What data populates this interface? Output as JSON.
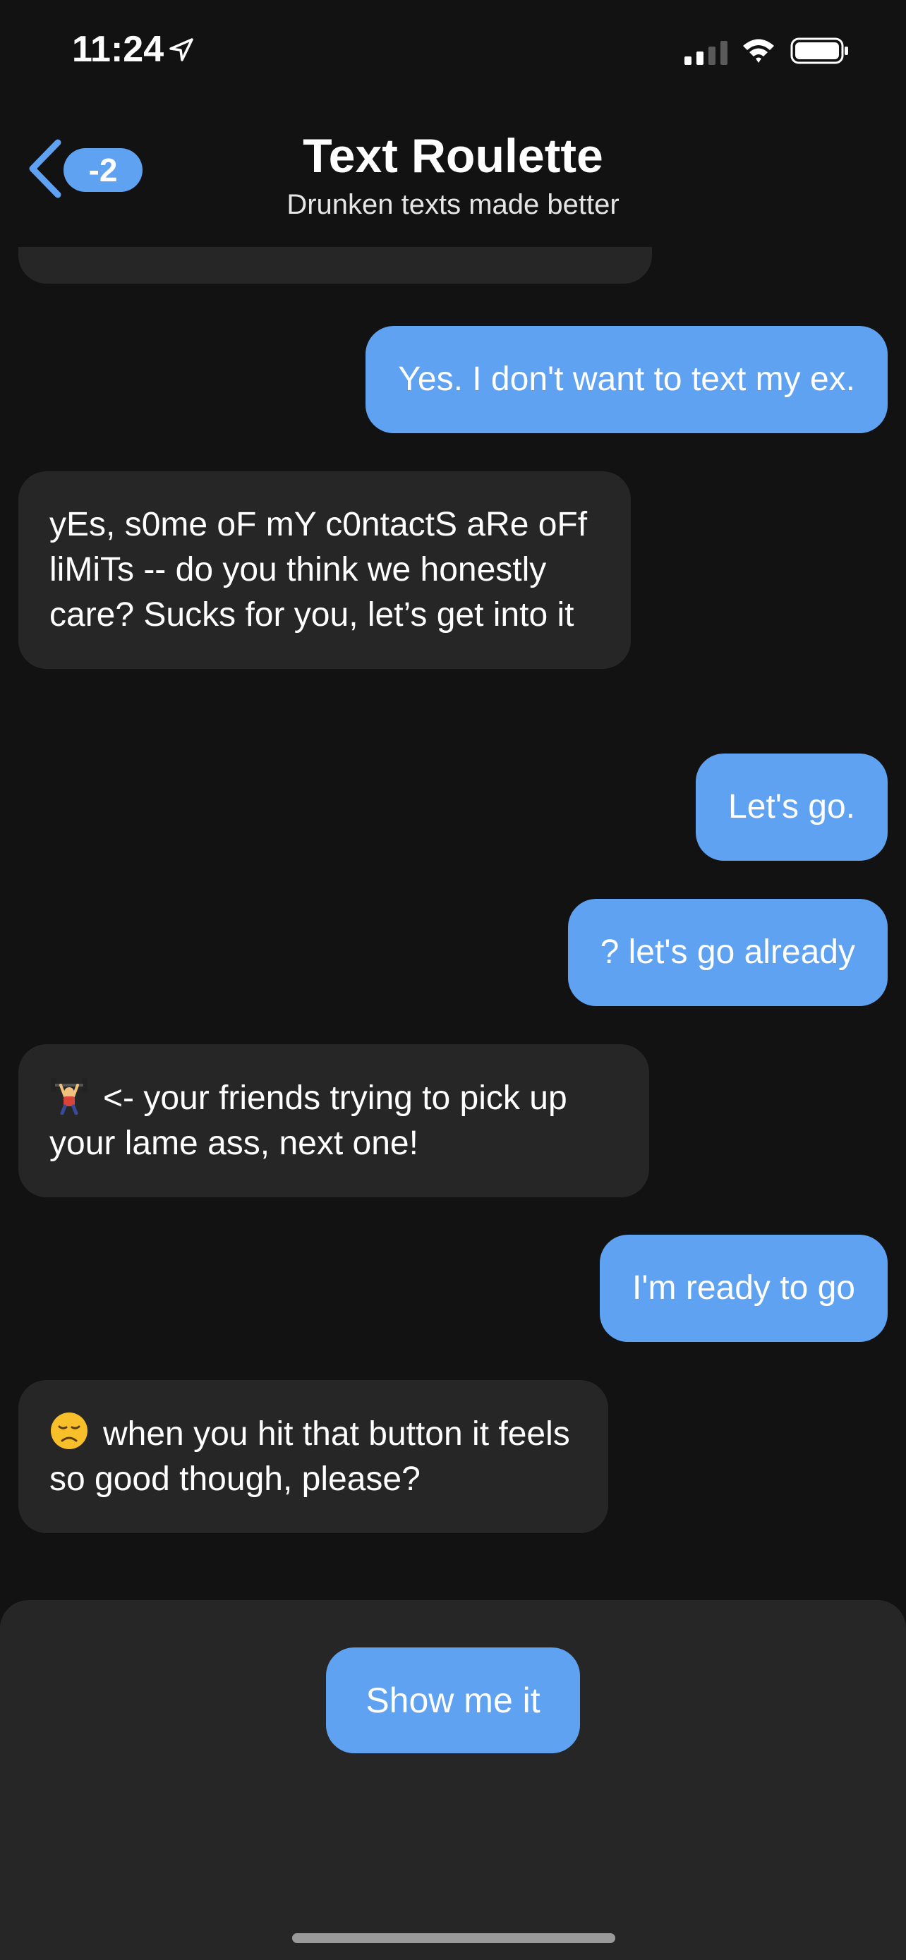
{
  "status_bar": {
    "time": "11:24",
    "location_icon": "location-arrow-icon",
    "signal_icon": "cellular-signal-icon",
    "wifi_icon": "wifi-icon",
    "battery_icon": "battery-icon"
  },
  "header": {
    "back_icon": "chevron-left-icon",
    "badge": "-2",
    "title": "Text Roulette",
    "subtitle": "Drunken texts made better"
  },
  "messages": [
    {
      "side": "out",
      "text": "Yes. I don't want to text my ex."
    },
    {
      "side": "in",
      "text": "yEs, s0me oF mY c0ntactS aRe oFf liMiTs -- do you think we honestly care? Sucks for you, let’s get into it"
    },
    {
      "side": "out",
      "text": "Let's go."
    },
    {
      "side": "out",
      "text": "? let's go already"
    },
    {
      "side": "in",
      "emoji": "weightlifter-emoji",
      "text": "<- your friends trying to pick up your lame ass, next one!"
    },
    {
      "side": "out",
      "text": "I'm ready to go"
    },
    {
      "side": "in",
      "emoji": "disappointed-face-emoji",
      "text": "when you hit that button it feels so good though, please?"
    }
  ],
  "action": {
    "button_label": "Show me it"
  },
  "colors": {
    "background": "#121212",
    "incoming_bubble": "#262626",
    "outgoing_bubble": "#5fa2f2",
    "accent": "#5fa2f2"
  }
}
